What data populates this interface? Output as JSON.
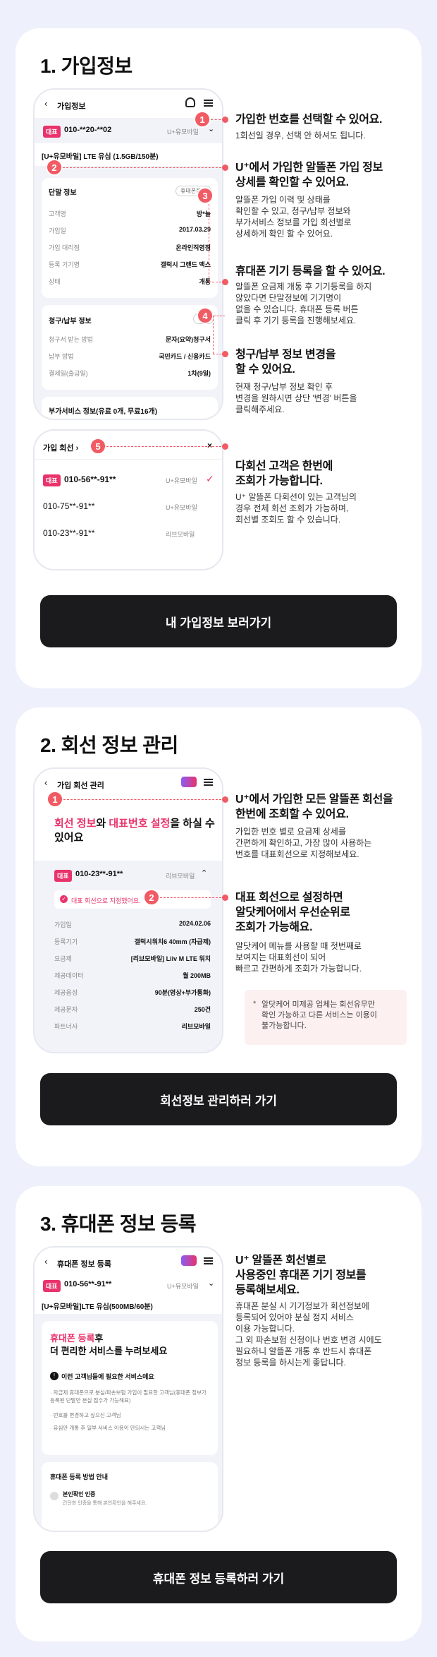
{
  "section1": {
    "title": "1. 가입정보",
    "phone_title": "가입정보",
    "number": "010-**20-**02",
    "badge": "대표",
    "carrier": "U+유모바일",
    "plan": "[U+유모바일] LTE 유심 (1.5GB/150분)",
    "device_head": "단말 정보",
    "device_btn": "휴대폰등록",
    "device_rows": [
      {
        "label": "고객명",
        "value": "방*늘"
      },
      {
        "label": "가입일",
        "value": "2017.03.29"
      },
      {
        "label": "가입 대리점",
        "value": "온라인직영점"
      },
      {
        "label": "등록 기기명",
        "value": "갤럭시 그랜드 맥스"
      },
      {
        "label": "상태",
        "value": "개통"
      }
    ],
    "billing_head": "청구/납부 정보",
    "billing_btn": "변경",
    "billing_rows": [
      {
        "label": "청구서 받는 방법",
        "value": "문자(요약)청구서"
      },
      {
        "label": "납부 방법",
        "value": "국민카드 / 신용카드"
      },
      {
        "label": "결제일(출금일)",
        "value": "1차(9일)"
      }
    ],
    "cut_text": "부가서비스 정보(유료 0개, 무료16개)",
    "lines_title": "가입 회선",
    "lines": [
      {
        "number": "010-56**-91**",
        "carrier": "U+유모바일",
        "main": true,
        "badge": "대표"
      },
      {
        "number": "010-75**-91**",
        "carrier": "U+유모바일",
        "main": false
      },
      {
        "number": "010-23**-91**",
        "carrier": "리브모바일",
        "main": false
      }
    ],
    "descs": [
      {
        "title": "가입한 번호를 선택할 수 있어요.",
        "text": "1회선일 경우, 선택 안 하셔도 됩니다."
      },
      {
        "title": "U⁺에서 가입한 알뜰폰 가입 정보\n상세를 확인할 수 있어요.",
        "text": "알뜰폰 가입 이력 및 상태를\n확인할 수 있고, 청구/납부 정보와\n부가서비스 정보를 가입 회선별로\n상세하게 확인 할 수 있어요."
      },
      {
        "title": "휴대폰 기기 등록을 할 수 있어요.",
        "text": "알뜰폰 요금제 개통 후 기기등록을 하지\n않았다면 단말정보에 기기명이\n없을 수 있습니다. 휴대폰 등록 버튼\n클릭 후 기기 등록을 진행해보세요."
      },
      {
        "title": "청구/납부 정보 변경을\n할 수 있어요.",
        "text": "현재 청구/납부 정보 확인 후\n변경을 원하시면 상단 '변경' 버튼을\n클릭해주세요."
      },
      {
        "title": "다회선 고객은 한번에\n조회가 가능합니다.",
        "text": "U⁺ 알뜰폰 다회선이 있는 고객님의\n경우 전체 회선 조회가 가능하며,\n회선별 조회도 할 수 있습니다."
      }
    ],
    "cta": "내 가입정보 보러가기"
  },
  "section2": {
    "title": "2. 회선 정보 관리",
    "phone_title": "가입 회선 관리",
    "head_a": "회선 정보",
    "head_b": "와 ",
    "head_c": "대표번호 설정",
    "head_d": "을 하실 수",
    "head_e": "있어요",
    "badge": "대표",
    "number": "010-23**-91**",
    "carrier": "리브모바일",
    "set_text": "대표 회선으로 지정했어요.",
    "rows": [
      {
        "label": "가입일",
        "value": "2024.02.06"
      },
      {
        "label": "등록기기",
        "value": "갤럭시워치6 40mm (자급제)"
      },
      {
        "label": "요금제",
        "value": "[리브모바일] Liiv M LTE 워치"
      },
      {
        "label": "제공데이터",
        "value": "월 200MB"
      },
      {
        "label": "제공음성",
        "value": "90분(영상+부가통화)"
      },
      {
        "label": "제공문자",
        "value": "250건"
      },
      {
        "label": "파트너사",
        "value": "리브모바일"
      }
    ],
    "descs": [
      {
        "title": "U⁺에서 가입한 모든 알뜰폰 회선을\n한번에 조회할 수 있어요.",
        "text": "가입한 번호 별로 요금제 상세를\n간편하게 확인하고, 가장 많이 사용하는\n번호를 대표회선으로 지정해보세요."
      },
      {
        "title": "대표 회선으로 설정하면\n알닷케어에서 우선순위로\n조회가 가능해요.",
        "text": "알닷케어 메뉴를 사용할 때 첫번째로\n보여지는 대표회선이 되어\n빠르고 간편하게 조회가 가능합니다."
      }
    ],
    "notice": "알닷케어 미제공 업체는 회선유무만\n확인 가능하고 다른 서비스는 이용이\n불가능합니다.",
    "cta": "회선정보 관리하러 가기"
  },
  "section3": {
    "title": "3. 휴대폰 정보 등록",
    "phone_title": "휴대폰 정보 등록",
    "badge": "대표",
    "number": "010-56**-91**",
    "carrier": "U+유모바일",
    "plan": "[U+유모바일]LTE 유심(500MB/60분)",
    "head_a": "휴대폰 등록",
    "head_b": "후",
    "head_c": "더 편리한 서비스를 누려보세요",
    "info_head": "이런 고객님들에 필요한 서비스예요",
    "bullets": [
      "· 자급제 휴대폰으로 분실/파손보험 가입이 필요한 고객님(휴대폰 정보가 등록된 단말만 분실 접수가 가능해요)",
      "· 번호를 변경하고 싶으신 고객님",
      "· 유심만 개통 후 일부 서비스 이용이 안되시는 고객님"
    ],
    "method_head": "휴대폰 등록 방법 안내",
    "method_title": "본인확인 인증",
    "method_text": "간단한 인증을 통해 본인확인을 해주세요.",
    "desc_title": "U⁺ 알뜰폰 회선별로\n사용중인 휴대폰 기기 정보를\n등록해보세요.",
    "desc_text": "휴대폰 분실 시 기기정보가 회선정보에\n등록되어 있어야 분실 정지 서비스\n이용 가능합니다.\n그 외 파손보험 신청이나 번호 변경 시에도\n필요하니 알뜰폰 개통 후 반드시 휴대폰\n정보 등록을 하시는게 좋답니다.",
    "cta": "휴대폰 정보 등록하러 가기"
  },
  "colors": {
    "accent": "#f15b64",
    "brand": "#e8336b",
    "dark": "#1b1b1d",
    "background": "#eef1fb"
  }
}
